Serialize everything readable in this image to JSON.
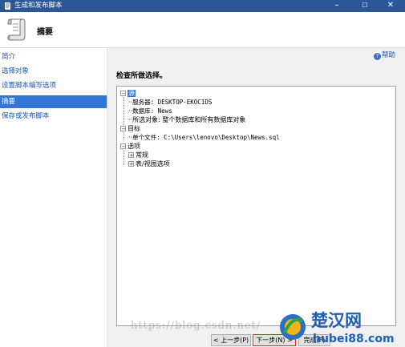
{
  "window": {
    "title": "生成和发布脚本",
    "min": "–",
    "max": "☐",
    "close": "✕"
  },
  "header": {
    "title": "摘要"
  },
  "sidebar": {
    "items": [
      {
        "label": "简介"
      },
      {
        "label": "选择对象"
      },
      {
        "label": "设置脚本编写选项"
      },
      {
        "label": "摘要",
        "active": true
      },
      {
        "label": "保存或发布脚本"
      }
    ]
  },
  "help": {
    "label": "帮助"
  },
  "main": {
    "title": "检查所做选择。"
  },
  "tree": {
    "root": "源",
    "server": "服务器: DESKTOP-EKOC1DS",
    "database": "数据库: News",
    "selected": "所选对象: 整个数据库和所有数据库对象",
    "target": "目标",
    "file": "单个文件: C:\\Users\\lenovo\\Desktop\\News.sql",
    "options": "选项",
    "general": "常规",
    "table_view": "表/视图选项"
  },
  "buttons": {
    "prev": "< 上一步(P)",
    "next": "下一步(N) >",
    "finish": "完成(F)"
  },
  "watermark": "https://blog.csdn.net/",
  "logo": {
    "name": "楚汉网",
    "url": "hubei88.com"
  },
  "colors": {
    "titlebar": "#2b5797",
    "accent": "#3374d6",
    "link": "#1a56b8"
  }
}
